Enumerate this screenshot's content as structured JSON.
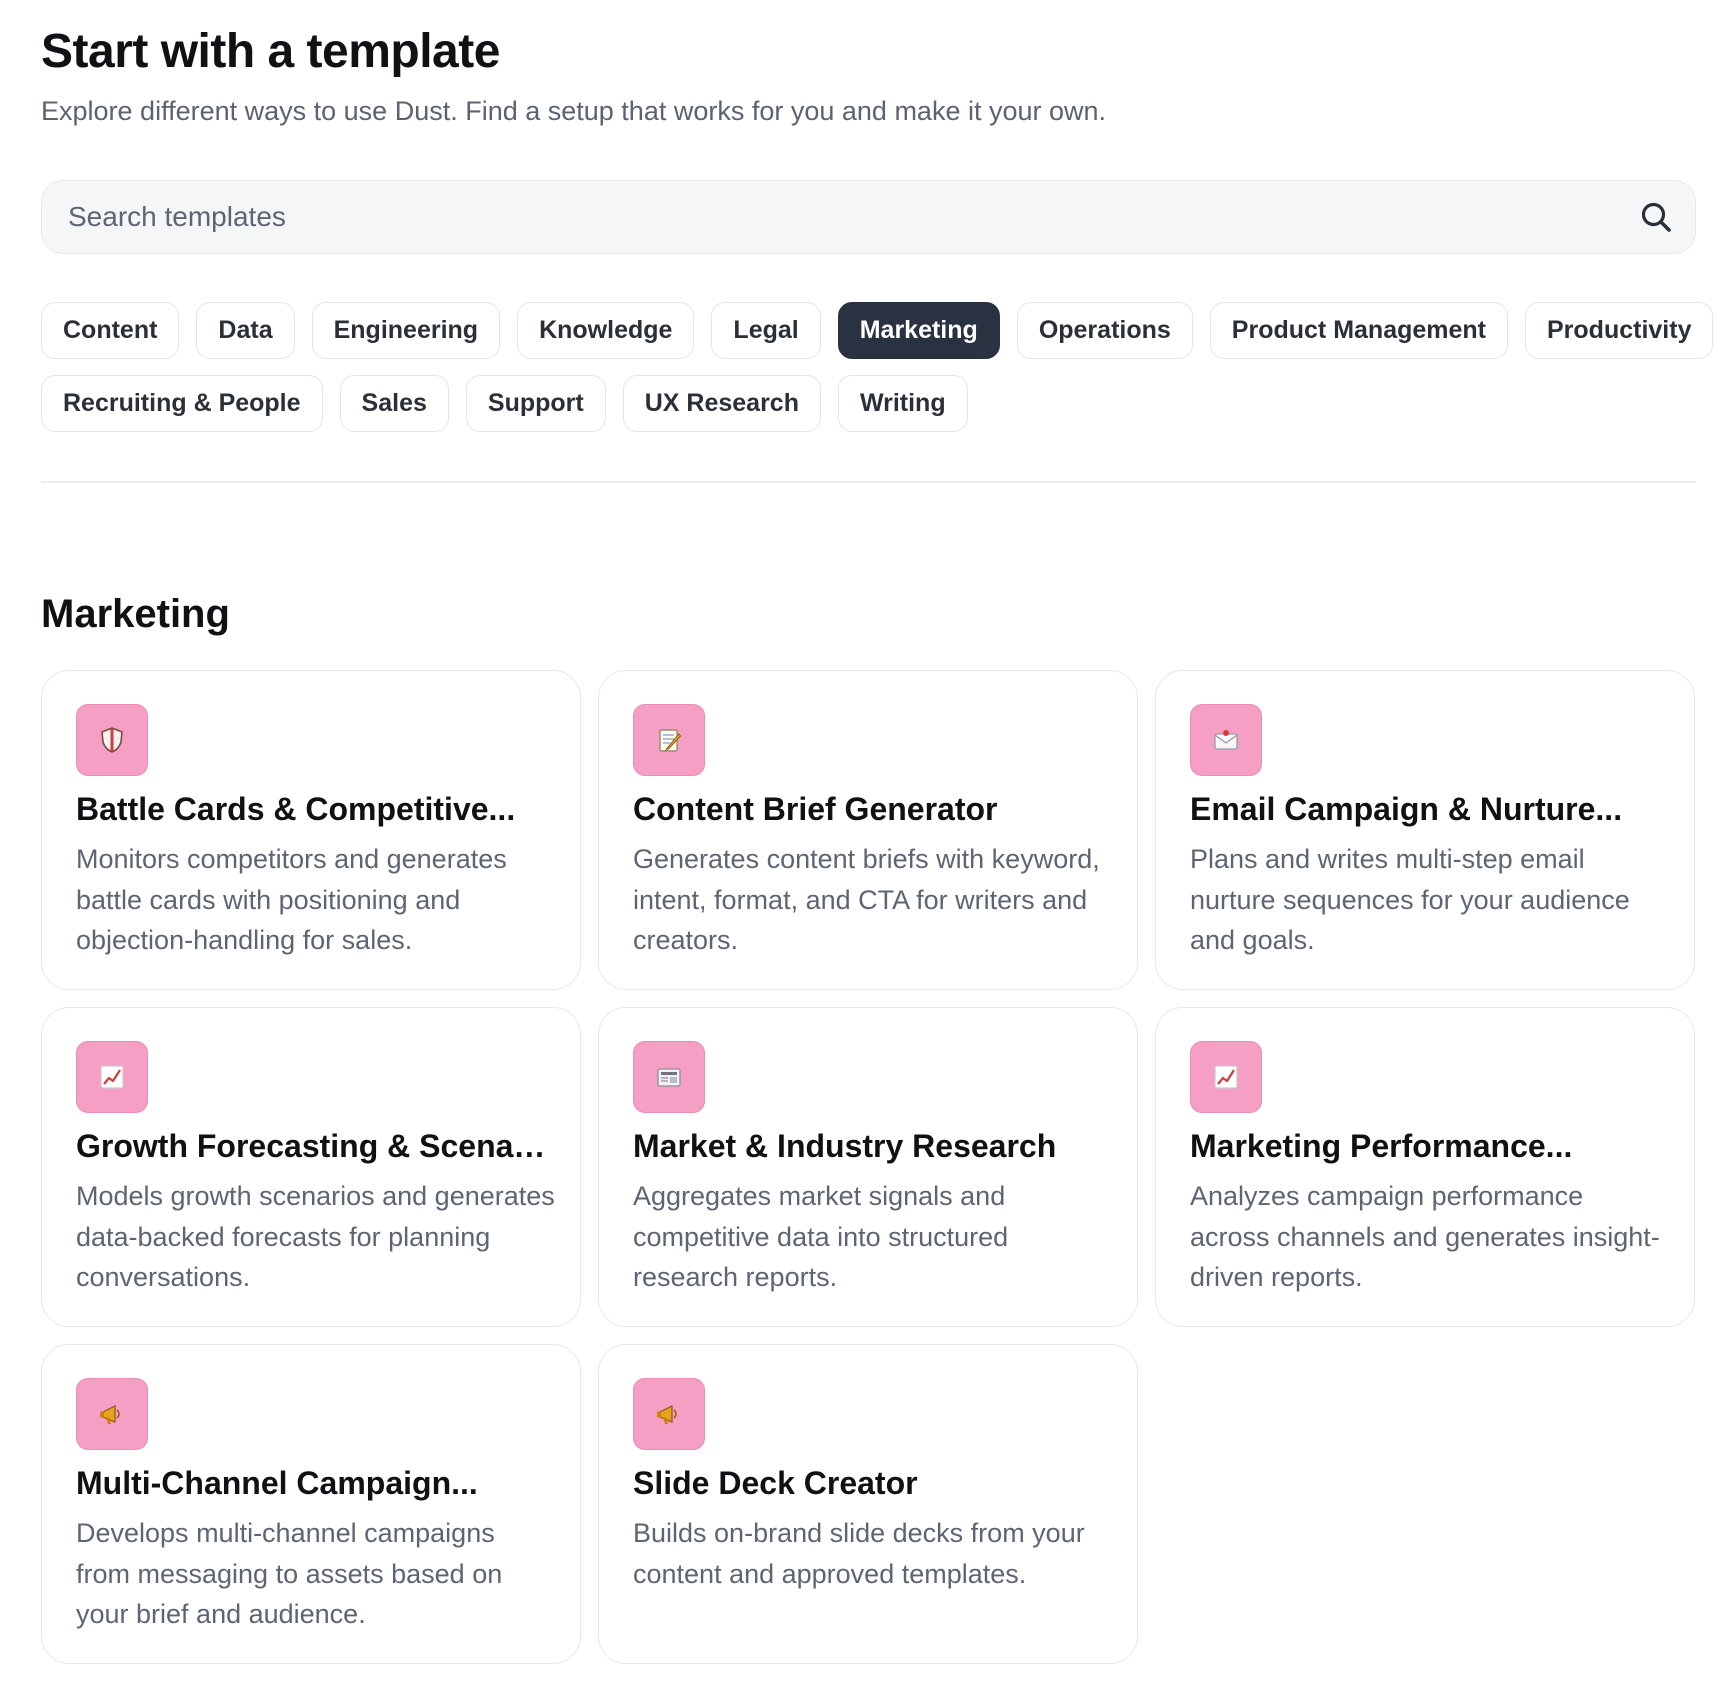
{
  "header": {
    "title": "Start with a template",
    "subtitle": "Explore different ways to use Dust. Find a setup that works for you and make it your own."
  },
  "search": {
    "placeholder": "Search templates",
    "value": "",
    "icon": "search-icon"
  },
  "categories": {
    "row1": [
      "Content",
      "Data",
      "Engineering",
      "Knowledge",
      "Legal",
      "Marketing",
      "Operations",
      "Product Management",
      "Productivity"
    ],
    "row2": [
      "Recruiting & People",
      "Sales",
      "Support",
      "UX Research",
      "Writing"
    ],
    "selected": "Marketing"
  },
  "section": {
    "title": "Marketing"
  },
  "templates": [
    {
      "name": "Battle Cards & Competitive...",
      "description": "Monitors competitors and generates battle cards with positioning and objection-handling for sales.",
      "icon": "shield-icon"
    },
    {
      "name": "Content Brief Generator",
      "description": "Generates content briefs with keyword, intent, format, and CTA for writers and creators.",
      "icon": "memo-icon"
    },
    {
      "name": "Email Campaign & Nurture...",
      "description": "Plans and writes multi-step email nurture sequences for your audience and goals.",
      "icon": "envelope-icon"
    },
    {
      "name": "Growth Forecasting & Scenari...",
      "description": "Models growth scenarios and generates data-backed forecasts for planning conversations.",
      "icon": "chart-increasing-icon"
    },
    {
      "name": "Market & Industry Research",
      "description": "Aggregates market signals and competitive data into structured research reports.",
      "icon": "newspaper-icon"
    },
    {
      "name": "Marketing Performance...",
      "description": "Analyzes campaign performance across channels and generates insight-driven reports.",
      "icon": "chart-increasing-icon"
    },
    {
      "name": "Multi-Channel Campaign...",
      "description": "Develops multi-channel campaigns from messaging to assets based on your brief and audience.",
      "icon": "megaphone-icon"
    },
    {
      "name": "Slide Deck Creator",
      "description": "Builds on-brand slide decks from your content and approved templates.",
      "icon": "megaphone-icon"
    }
  ],
  "colors": {
    "accent_chip": "#2a3140",
    "icon_badge": "#f49fc3",
    "muted_text": "#5e6572"
  }
}
